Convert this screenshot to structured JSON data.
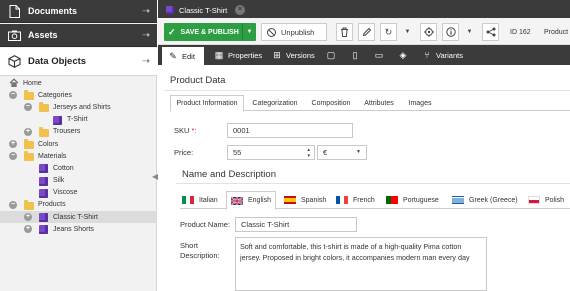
{
  "sidebar": {
    "documents_label": "Documents",
    "assets_label": "Assets",
    "data_objects_label": "Data Objects",
    "tree": [
      {
        "label": "Home",
        "depth": 0,
        "icon": "home-icon",
        "expander": "none"
      },
      {
        "label": "Categories",
        "depth": 1,
        "icon": "folder-icon",
        "expander": "minus"
      },
      {
        "label": "Jerseys and Shirts",
        "depth": 2,
        "icon": "folder-icon",
        "expander": "minus"
      },
      {
        "label": "T-Shirt",
        "depth": 3,
        "icon": "object-icon",
        "expander": "none"
      },
      {
        "label": "Trousers",
        "depth": 2,
        "icon": "folder-icon",
        "expander": "plus"
      },
      {
        "label": "Colors",
        "depth": 1,
        "icon": "folder-icon",
        "expander": "plus"
      },
      {
        "label": "Materials",
        "depth": 1,
        "icon": "folder-icon",
        "expander": "minus"
      },
      {
        "label": "Cotton",
        "depth": 2,
        "icon": "object-icon",
        "expander": "none"
      },
      {
        "label": "Silk",
        "depth": 2,
        "icon": "object-icon",
        "expander": "none"
      },
      {
        "label": "Viscose",
        "depth": 2,
        "icon": "object-icon",
        "expander": "none"
      },
      {
        "label": "Products",
        "depth": 1,
        "icon": "folder-icon",
        "expander": "minus"
      },
      {
        "label": "Classic T-Shirt",
        "depth": 2,
        "icon": "object-icon",
        "expander": "plus",
        "selected": true
      },
      {
        "label": "Jeans Shorts",
        "depth": 2,
        "icon": "object-icon",
        "expander": "plus"
      }
    ]
  },
  "tab": {
    "title": "Classic T-Shirt"
  },
  "toolbar": {
    "save_label": "SAVE & PUBLISH",
    "unpublish_label": "Unpublish",
    "id_label": "ID 162",
    "class_label": "Product"
  },
  "subtabs": {
    "edit": "Edit",
    "properties": "Properties",
    "versions": "Versions",
    "variants": "Variants"
  },
  "panel": {
    "title": "Product Data",
    "tabs": [
      "Product Information",
      "Categorization",
      "Composition",
      "Attributes",
      "Images"
    ]
  },
  "form": {
    "sku_label": "SKU",
    "sku_required_mark": "*:",
    "sku_value": "0001",
    "price_label": "Price:",
    "price_value": "55",
    "currency_value": "€",
    "name_desc_title": "Name and Description",
    "languages": [
      "Italian",
      "English",
      "Spanish",
      "French",
      "Portuguese",
      "Greek (Greece)",
      "Polish"
    ],
    "product_name_label": "Product Name:",
    "product_name_value": "Classic T-Shirt",
    "short_desc_label": "Short Description:",
    "short_desc_value": "Soft and comfortable, this t-shirt is made of a high-quality Pima cotton jersey. Proposed in bright colors, it accompanies modern man every day"
  },
  "colors": {
    "sidebar_dark": "#3b3b3b",
    "accent_green": "#2e9e44",
    "object_purple": "#7b48c9",
    "folder_yellow": "#f0c24b"
  }
}
